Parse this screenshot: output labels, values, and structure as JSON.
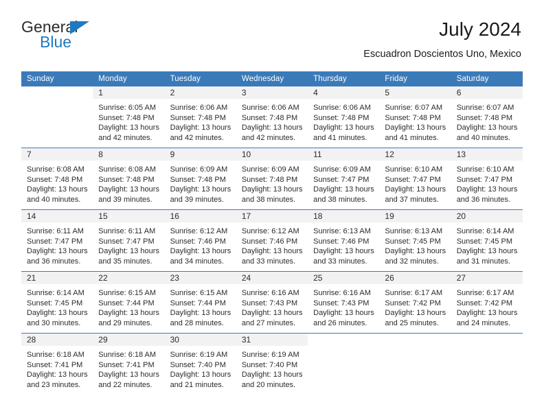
{
  "brand": {
    "name_part1": "General",
    "name_part2": "Blue",
    "triangle_icon": "triangle-icon",
    "accent_color": "#1f7ac0"
  },
  "header": {
    "title": "July 2024",
    "subtitle": "Escuadron Doscientos Uno, Mexico"
  },
  "colors": {
    "header_blue": "#3b7ab8",
    "daynum_band": "#f2f2f2",
    "text": "#2b2b2b"
  },
  "weekday_headers": [
    "Sunday",
    "Monday",
    "Tuesday",
    "Wednesday",
    "Thursday",
    "Friday",
    "Saturday"
  ],
  "weeks": [
    [
      {
        "day": "",
        "blank": true,
        "sunrise": "",
        "sunset": "",
        "daylight1": "",
        "daylight2": ""
      },
      {
        "day": "1",
        "sunrise": "Sunrise: 6:05 AM",
        "sunset": "Sunset: 7:48 PM",
        "daylight1": "Daylight: 13 hours",
        "daylight2": "and 42 minutes."
      },
      {
        "day": "2",
        "sunrise": "Sunrise: 6:06 AM",
        "sunset": "Sunset: 7:48 PM",
        "daylight1": "Daylight: 13 hours",
        "daylight2": "and 42 minutes."
      },
      {
        "day": "3",
        "sunrise": "Sunrise: 6:06 AM",
        "sunset": "Sunset: 7:48 PM",
        "daylight1": "Daylight: 13 hours",
        "daylight2": "and 42 minutes."
      },
      {
        "day": "4",
        "sunrise": "Sunrise: 6:06 AM",
        "sunset": "Sunset: 7:48 PM",
        "daylight1": "Daylight: 13 hours",
        "daylight2": "and 41 minutes."
      },
      {
        "day": "5",
        "sunrise": "Sunrise: 6:07 AM",
        "sunset": "Sunset: 7:48 PM",
        "daylight1": "Daylight: 13 hours",
        "daylight2": "and 41 minutes."
      },
      {
        "day": "6",
        "sunrise": "Sunrise: 6:07 AM",
        "sunset": "Sunset: 7:48 PM",
        "daylight1": "Daylight: 13 hours",
        "daylight2": "and 40 minutes."
      }
    ],
    [
      {
        "day": "7",
        "sunrise": "Sunrise: 6:08 AM",
        "sunset": "Sunset: 7:48 PM",
        "daylight1": "Daylight: 13 hours",
        "daylight2": "and 40 minutes."
      },
      {
        "day": "8",
        "sunrise": "Sunrise: 6:08 AM",
        "sunset": "Sunset: 7:48 PM",
        "daylight1": "Daylight: 13 hours",
        "daylight2": "and 39 minutes."
      },
      {
        "day": "9",
        "sunrise": "Sunrise: 6:09 AM",
        "sunset": "Sunset: 7:48 PM",
        "daylight1": "Daylight: 13 hours",
        "daylight2": "and 39 minutes."
      },
      {
        "day": "10",
        "sunrise": "Sunrise: 6:09 AM",
        "sunset": "Sunset: 7:48 PM",
        "daylight1": "Daylight: 13 hours",
        "daylight2": "and 38 minutes."
      },
      {
        "day": "11",
        "sunrise": "Sunrise: 6:09 AM",
        "sunset": "Sunset: 7:47 PM",
        "daylight1": "Daylight: 13 hours",
        "daylight2": "and 38 minutes."
      },
      {
        "day": "12",
        "sunrise": "Sunrise: 6:10 AM",
        "sunset": "Sunset: 7:47 PM",
        "daylight1": "Daylight: 13 hours",
        "daylight2": "and 37 minutes."
      },
      {
        "day": "13",
        "sunrise": "Sunrise: 6:10 AM",
        "sunset": "Sunset: 7:47 PM",
        "daylight1": "Daylight: 13 hours",
        "daylight2": "and 36 minutes."
      }
    ],
    [
      {
        "day": "14",
        "sunrise": "Sunrise: 6:11 AM",
        "sunset": "Sunset: 7:47 PM",
        "daylight1": "Daylight: 13 hours",
        "daylight2": "and 36 minutes."
      },
      {
        "day": "15",
        "sunrise": "Sunrise: 6:11 AM",
        "sunset": "Sunset: 7:47 PM",
        "daylight1": "Daylight: 13 hours",
        "daylight2": "and 35 minutes."
      },
      {
        "day": "16",
        "sunrise": "Sunrise: 6:12 AM",
        "sunset": "Sunset: 7:46 PM",
        "daylight1": "Daylight: 13 hours",
        "daylight2": "and 34 minutes."
      },
      {
        "day": "17",
        "sunrise": "Sunrise: 6:12 AM",
        "sunset": "Sunset: 7:46 PM",
        "daylight1": "Daylight: 13 hours",
        "daylight2": "and 33 minutes."
      },
      {
        "day": "18",
        "sunrise": "Sunrise: 6:13 AM",
        "sunset": "Sunset: 7:46 PM",
        "daylight1": "Daylight: 13 hours",
        "daylight2": "and 33 minutes."
      },
      {
        "day": "19",
        "sunrise": "Sunrise: 6:13 AM",
        "sunset": "Sunset: 7:45 PM",
        "daylight1": "Daylight: 13 hours",
        "daylight2": "and 32 minutes."
      },
      {
        "day": "20",
        "sunrise": "Sunrise: 6:14 AM",
        "sunset": "Sunset: 7:45 PM",
        "daylight1": "Daylight: 13 hours",
        "daylight2": "and 31 minutes."
      }
    ],
    [
      {
        "day": "21",
        "sunrise": "Sunrise: 6:14 AM",
        "sunset": "Sunset: 7:45 PM",
        "daylight1": "Daylight: 13 hours",
        "daylight2": "and 30 minutes."
      },
      {
        "day": "22",
        "sunrise": "Sunrise: 6:15 AM",
        "sunset": "Sunset: 7:44 PM",
        "daylight1": "Daylight: 13 hours",
        "daylight2": "and 29 minutes."
      },
      {
        "day": "23",
        "sunrise": "Sunrise: 6:15 AM",
        "sunset": "Sunset: 7:44 PM",
        "daylight1": "Daylight: 13 hours",
        "daylight2": "and 28 minutes."
      },
      {
        "day": "24",
        "sunrise": "Sunrise: 6:16 AM",
        "sunset": "Sunset: 7:43 PM",
        "daylight1": "Daylight: 13 hours",
        "daylight2": "and 27 minutes."
      },
      {
        "day": "25",
        "sunrise": "Sunrise: 6:16 AM",
        "sunset": "Sunset: 7:43 PM",
        "daylight1": "Daylight: 13 hours",
        "daylight2": "and 26 minutes."
      },
      {
        "day": "26",
        "sunrise": "Sunrise: 6:17 AM",
        "sunset": "Sunset: 7:42 PM",
        "daylight1": "Daylight: 13 hours",
        "daylight2": "and 25 minutes."
      },
      {
        "day": "27",
        "sunrise": "Sunrise: 6:17 AM",
        "sunset": "Sunset: 7:42 PM",
        "daylight1": "Daylight: 13 hours",
        "daylight2": "and 24 minutes."
      }
    ],
    [
      {
        "day": "28",
        "sunrise": "Sunrise: 6:18 AM",
        "sunset": "Sunset: 7:41 PM",
        "daylight1": "Daylight: 13 hours",
        "daylight2": "and 23 minutes."
      },
      {
        "day": "29",
        "sunrise": "Sunrise: 6:18 AM",
        "sunset": "Sunset: 7:41 PM",
        "daylight1": "Daylight: 13 hours",
        "daylight2": "and 22 minutes."
      },
      {
        "day": "30",
        "sunrise": "Sunrise: 6:19 AM",
        "sunset": "Sunset: 7:40 PM",
        "daylight1": "Daylight: 13 hours",
        "daylight2": "and 21 minutes."
      },
      {
        "day": "31",
        "sunrise": "Sunrise: 6:19 AM",
        "sunset": "Sunset: 7:40 PM",
        "daylight1": "Daylight: 13 hours",
        "daylight2": "and 20 minutes."
      },
      {
        "day": "",
        "blank": true,
        "sunrise": "",
        "sunset": "",
        "daylight1": "",
        "daylight2": ""
      },
      {
        "day": "",
        "blank": true,
        "sunrise": "",
        "sunset": "",
        "daylight1": "",
        "daylight2": ""
      },
      {
        "day": "",
        "blank": true,
        "sunrise": "",
        "sunset": "",
        "daylight1": "",
        "daylight2": ""
      }
    ]
  ]
}
